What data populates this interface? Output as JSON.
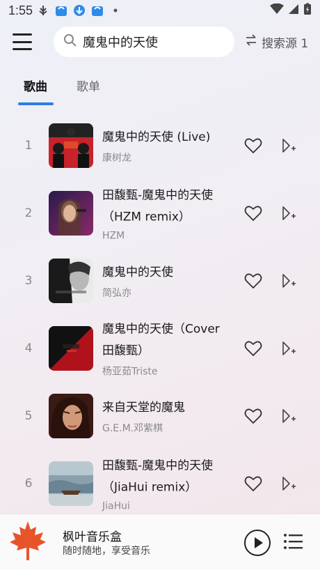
{
  "status": {
    "time": "1:55"
  },
  "header": {
    "search_query": "魔鬼中的天使",
    "source_label": "搜索源 1"
  },
  "tabs": [
    {
      "label": "歌曲",
      "active": true
    },
    {
      "label": "歌单",
      "active": false
    }
  ],
  "songs": [
    {
      "index": "1",
      "title_line1": "魔鬼中的天使 (Live)",
      "title_line2": "",
      "artist": "康树龙",
      "cover_color": "#c8222a"
    },
    {
      "index": "2",
      "title_line1": "田馥甄-魔鬼中的天使",
      "title_line2": "（HZM remix）",
      "artist": "HZM",
      "cover_color": "#6a2a5a"
    },
    {
      "index": "3",
      "title_line1": "魔鬼中的天使",
      "title_line2": "",
      "artist": "简弘亦",
      "cover_color": "#d8d8d8"
    },
    {
      "index": "4",
      "title_line1": "魔鬼中的天使（Cover",
      "title_line2": "田馥甄）",
      "artist": "杨亚茹Triste",
      "cover_color": "#b0121c"
    },
    {
      "index": "5",
      "title_line1": "来自天堂的魔鬼",
      "title_line2": "",
      "artist": "G.E.M.邓紫棋",
      "cover_color": "#5a2a20"
    },
    {
      "index": "6",
      "title_line1": "田馥甄-魔鬼中的天使",
      "title_line2": "（JiaHui remix）",
      "artist": "JiaHui",
      "cover_color": "#7a9aa8"
    }
  ],
  "player": {
    "title": "枫叶音乐盒",
    "subtitle": "随时随地，享受音乐"
  },
  "colors": {
    "accent": "#2f7be6",
    "logo": "#e8542a"
  }
}
